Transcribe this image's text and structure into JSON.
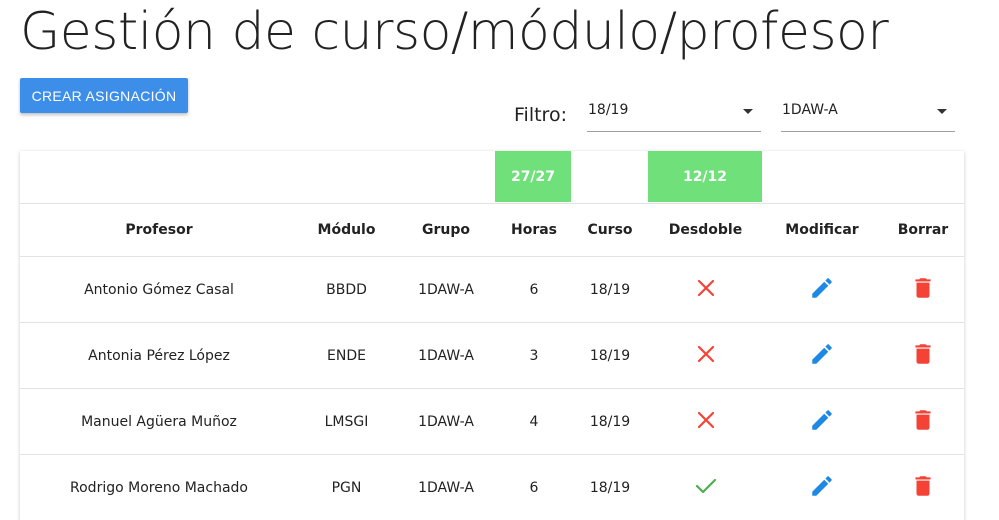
{
  "page": {
    "title": "Gestión de curso/módulo/profesor"
  },
  "actions": {
    "create_label": "CREAR ASIGNACIÓN"
  },
  "filter": {
    "label": "Filtro:",
    "curso": "18/19",
    "grupo": "1DAW-A"
  },
  "summary": {
    "horas": "27/27",
    "desdoble": "12/12"
  },
  "table": {
    "headers": {
      "profesor": "Profesor",
      "modulo": "Módulo",
      "grupo": "Grupo",
      "horas": "Horas",
      "curso": "Curso",
      "desdoble": "Desdoble",
      "modificar": "Modificar",
      "borrar": "Borrar"
    },
    "rows": [
      {
        "profesor": "Antonio Gómez Casal",
        "modulo": "BBDD",
        "grupo": "1DAW-A",
        "horas": "6",
        "curso": "18/19",
        "desdoble": false
      },
      {
        "profesor": "Antonia Pérez López",
        "modulo": "ENDE",
        "grupo": "1DAW-A",
        "horas": "3",
        "curso": "18/19",
        "desdoble": false
      },
      {
        "profesor": "Manuel Agüera Muñoz",
        "modulo": "LMSGI",
        "grupo": "1DAW-A",
        "horas": "4",
        "curso": "18/19",
        "desdoble": false
      },
      {
        "profesor": "Rodrigo Moreno Machado",
        "modulo": "PGN",
        "grupo": "1DAW-A",
        "horas": "6",
        "curso": "18/19",
        "desdoble": true
      }
    ]
  },
  "icons": {
    "desdoble_false": "close-icon",
    "desdoble_true": "check-icon",
    "modify": "pencil-icon",
    "delete": "trash-icon"
  },
  "colors": {
    "primary": "#3d8ee8",
    "success_pill": "#6fe07a",
    "cross": "#f44336",
    "check": "#4caf50",
    "edit": "#1e88e5",
    "delete": "#f44336"
  }
}
